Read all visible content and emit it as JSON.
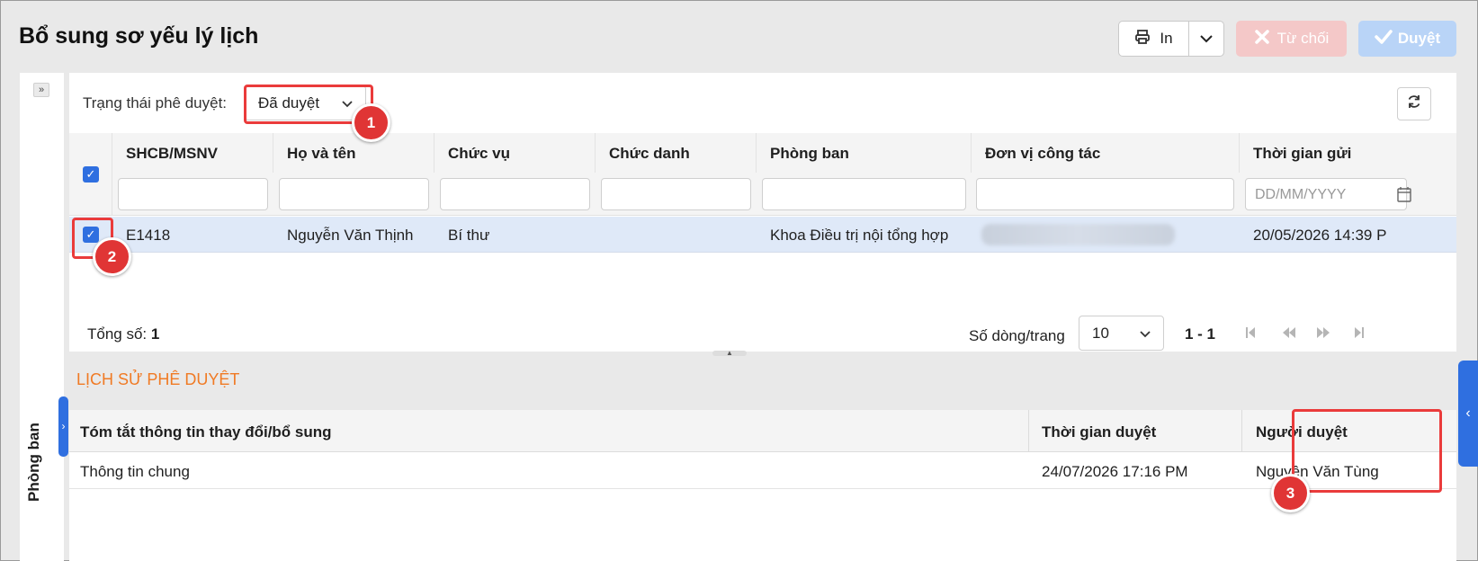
{
  "header": {
    "title": "Bổ sung sơ yếu lý lịch",
    "print_label": "In",
    "reject_label": "Từ chối",
    "approve_label": "Duyệt"
  },
  "sidebar": {
    "label": "Phòng ban"
  },
  "filter": {
    "label": "Trạng thái phê duyệt:",
    "status_value": "Đã duyệt"
  },
  "grid": {
    "columns": [
      "SHCB/MSNV",
      "Họ và tên",
      "Chức vụ",
      "Chức danh",
      "Phòng ban",
      "Đơn vị công tác",
      "Thời gian gửi"
    ],
    "date_placeholder": "DD/MM/YYYY",
    "rows": [
      {
        "id": "E1418",
        "name": "Nguyễn Văn Thịnh",
        "position": "Bí thư",
        "title": "",
        "department": "Khoa Điều trị nội tổng hợp",
        "unit": "",
        "sent_time": "20/05/2026 14:39 P"
      }
    ]
  },
  "footer": {
    "total_label": "Tổng số:",
    "total_value": "1",
    "rows_per_page_label": "Số dòng/trang",
    "rows_per_page_value": "10",
    "range": "1 - 1"
  },
  "history": {
    "title": "LỊCH SỬ PHÊ DUYỆT",
    "columns": [
      "Tóm tắt thông tin thay đổi/bổ sung",
      "Thời gian duyệt",
      "Người duyệt"
    ],
    "rows": [
      {
        "summary": "Thông tin chung",
        "time": "24/07/2026 17:16 PM",
        "approver": "Nguyên Văn Tùng"
      }
    ]
  },
  "annotations": [
    "1",
    "2",
    "3"
  ],
  "colors": {
    "accent": "#2f6fe0",
    "annotation_red": "#e03535",
    "history_title": "#f07a24",
    "reject_bg": "#f4c8c8",
    "approve_bg": "#b9d4f7",
    "selected_row": "#dfe9f8"
  }
}
